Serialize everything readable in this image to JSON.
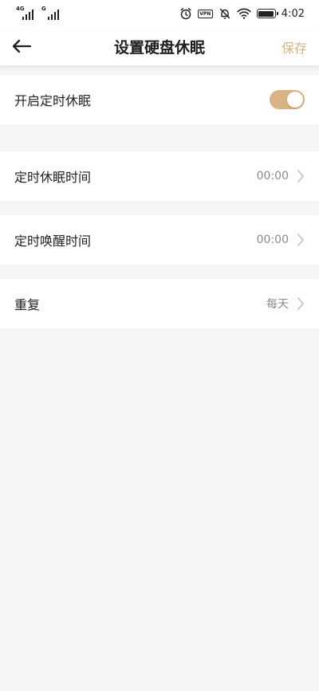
{
  "status_bar": {
    "signal_1_tag": "4G",
    "signal_2_tag": "G",
    "vpn_label": "VPN",
    "time": "4:02"
  },
  "header": {
    "title": "设置硬盘休眠",
    "save_label": "保存"
  },
  "settings": {
    "enable_label": "开启定时休眠",
    "enable_on": true,
    "sleep_time_label": "定时休眠时间",
    "sleep_time_value": "00:00",
    "wake_time_label": "定时唤醒时间",
    "wake_time_value": "00:00",
    "repeat_label": "重复",
    "repeat_value": "每天"
  },
  "colors": {
    "accent": "#d9b383",
    "background": "#f4f5f7",
    "chevron": "#c0c0c0"
  },
  "icons": {
    "back": "arrow-left-icon",
    "chevron": "chevron-right-icon",
    "alarm": "alarm-clock-icon",
    "mute": "bell-off-icon",
    "wifi": "wifi-icon",
    "battery": "battery-icon"
  }
}
